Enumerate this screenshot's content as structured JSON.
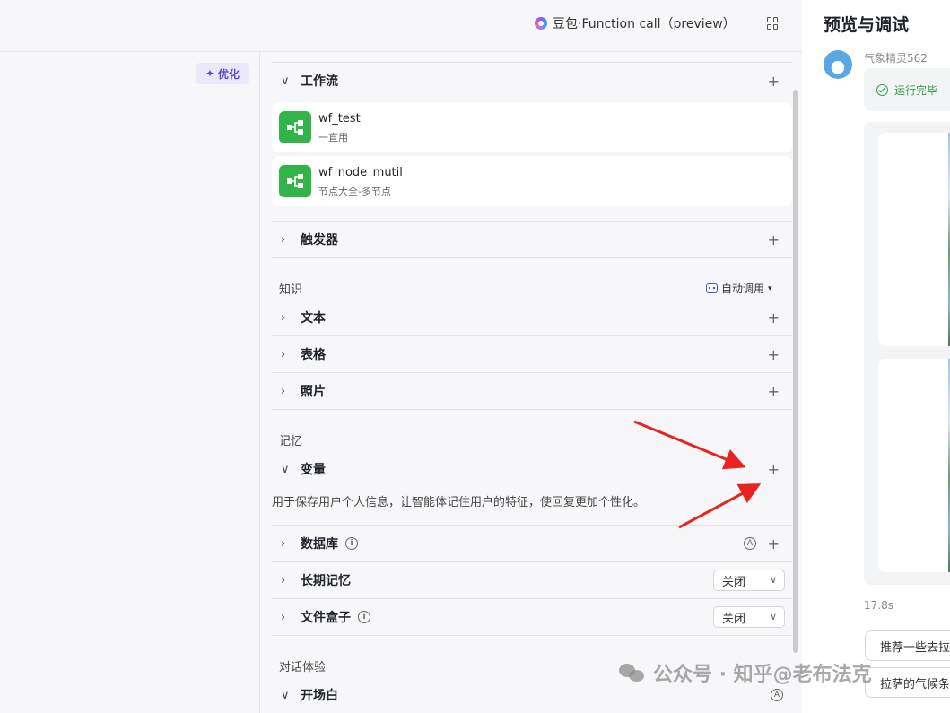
{
  "header": {
    "model_name": "豆包·Function call（preview）"
  },
  "left": {
    "optimize_label": "优化"
  },
  "workflow": {
    "title": "工作流",
    "items": [
      {
        "name": "wf_test",
        "desc": "一直用"
      },
      {
        "name": "wf_node_mutil",
        "desc": "节点大全-多节点"
      }
    ]
  },
  "trigger": {
    "title": "触发器"
  },
  "knowledge": {
    "label": "知识",
    "auto_call": "自动调用",
    "sections": [
      "文本",
      "表格",
      "照片"
    ]
  },
  "memory": {
    "label": "记忆",
    "variable_title": "变量",
    "variable_desc": "用于保存用户个人信息，让智能体记住用户的特征，使回复更加个性化。",
    "database_title": "数据库",
    "long_memory_title": "长期记忆",
    "long_memory_value": "关闭",
    "filebox_title": "文件盒子",
    "filebox_value": "关闭"
  },
  "dialog": {
    "label": "对话体验",
    "opening_title": "开场白"
  },
  "preview": {
    "title": "预览与调试",
    "bot_name": "气象精灵562",
    "status": "运行完毕",
    "elapsed": "17.8s",
    "suggestions": [
      "推荐一些去拉",
      "拉萨的气候条"
    ]
  },
  "watermark": {
    "text": "公众号 · 知乎@老布法克"
  }
}
